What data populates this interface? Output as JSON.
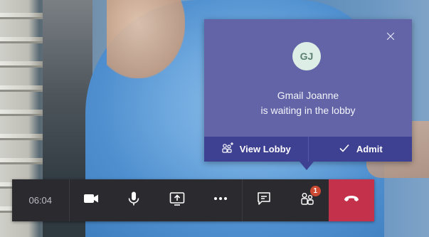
{
  "popup": {
    "avatar_initials": "GJ",
    "name_line": "Gmail Joanne",
    "status_line": "is waiting in the lobby",
    "view_lobby_label": "View Lobby",
    "admit_label": "Admit",
    "colors": {
      "background": "#6264a7",
      "action_bar": "#3e4092"
    }
  },
  "toolbar": {
    "call_duration": "06:04",
    "participants_badge": "1",
    "icons": [
      "video-camera-icon",
      "microphone-icon",
      "share-screen-icon",
      "more-options-icon",
      "chat-icon",
      "participants-icon",
      "hang-up-icon"
    ],
    "colors": {
      "background": "#2b2b2f",
      "hangup": "#c4314b"
    }
  }
}
